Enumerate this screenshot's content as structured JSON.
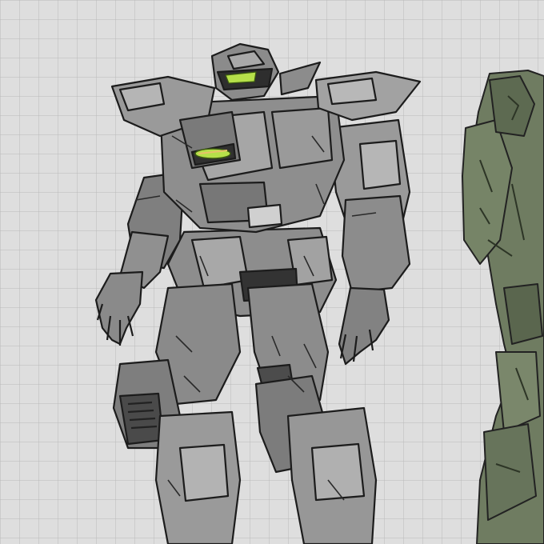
{
  "image": {
    "subject": "grey-mech-sketch",
    "background": "grid-paper"
  },
  "colors": {
    "paper": "#dedede",
    "grid_line": "#b9b9b9",
    "grey_armor": "#8a8a8a",
    "grey_light": "#b4b4b4",
    "grey_mid": "#9c9c9c",
    "grey_dark": "#3c3c3c",
    "ink": "#1c1c1c",
    "visor_glow": "#b6e04a",
    "green_armor": "#6f7c61",
    "green_dark": "#4a553f"
  }
}
